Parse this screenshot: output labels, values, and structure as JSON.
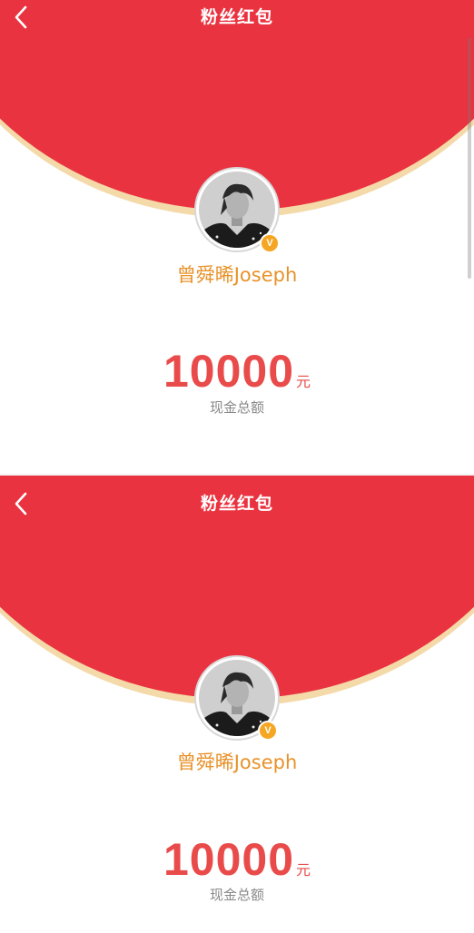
{
  "screens": [
    {
      "nav": {
        "title": "粉丝红包"
      },
      "profile": {
        "name": "曾舜晞Joseph",
        "badge": "V"
      },
      "packet": {
        "amount": "10000",
        "unit": "元",
        "caption": "现金总额"
      }
    },
    {
      "nav": {
        "title": "粉丝红包"
      },
      "profile": {
        "name": "曾舜晞Joseph",
        "badge": "V"
      },
      "packet": {
        "amount": "10000",
        "unit": "元",
        "caption": "现金总额"
      }
    }
  ],
  "icons": {
    "back": "chevron-left-icon",
    "verified": "verified-badge-icon"
  },
  "colors": {
    "red": "#ea3340",
    "gold_rim": "#f4d9a9",
    "name_orange": "#e8922a",
    "amount_red": "#e94b4b",
    "badge": "#f5a623",
    "caption_gray": "#888888"
  }
}
